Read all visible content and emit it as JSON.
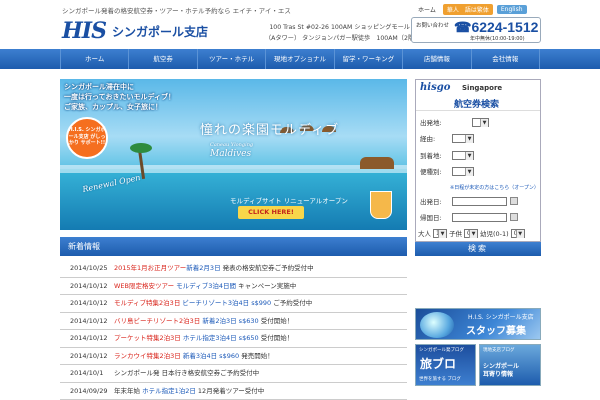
{
  "header": {
    "tagline": "シンガポール発着の格安航空券・ツアー・ホテル予約なら エイチ・アイ・エス",
    "logo": "HIS",
    "logo_sub": "シンガポール支店",
    "address_line1": "100 Tras St #02-26 100AM ショッピングモール",
    "address_line2": "（Aタワー） タンジョンパガー駅徒歩　100AM（2階）",
    "toplinks": {
      "home": "ホーム",
      "chinese": "華人　語は繁体",
      "english": "English"
    },
    "phone_label": "お問い合わせ",
    "phone": "6224-1512",
    "hours": "年中無休(10:00-19:00)"
  },
  "nav": [
    "ホーム",
    "航空券",
    "ツアー・ホテル",
    "現地オプショナル",
    "留学・ワーキング",
    "店舗情報",
    "会社情報"
  ],
  "banner": {
    "tagline_l1": "シンガポール滞在中に",
    "tagline_l2": "一度は行っておきたいモルディブ！",
    "tagline_l3": "ご家族、カップル、女子旅に！",
    "title": "憧れの楽園モルディブ",
    "logo_small": "Caneau Ylonging",
    "logo_big": "Maldives",
    "badge": "H.I.S. シンガポール支店 がしっかり サポート!!",
    "renew": "Renewal Open",
    "site": "モルディブサイト リニューアルオープン",
    "click": "CLICK HERE!"
  },
  "news": {
    "heading": "新着情報",
    "items": [
      {
        "date": "2014/10/25",
        "parts": [
          {
            "t": "2015年1月お正月ツアー",
            "c": "red"
          },
          {
            "t": "新着2月3日",
            "c": "blue"
          },
          {
            "t": " 発表の格安航空券ご予約受付中",
            "c": ""
          }
        ]
      },
      {
        "date": "2014/10/12",
        "parts": [
          {
            "t": "WEB限定格安ツアー",
            "c": "red"
          },
          {
            "t": " モルディブ3泊4日間 ",
            "c": "blue"
          },
          {
            "t": "キャンペーン実施中",
            "c": ""
          }
        ]
      },
      {
        "date": "2014/10/12",
        "parts": [
          {
            "t": "モルディブ特集2泊3日",
            "c": "red"
          },
          {
            "t": " ビーチリゾート3泊4日 s$990",
            "c": "blue"
          },
          {
            "t": " ご予約受付中",
            "c": ""
          }
        ]
      },
      {
        "date": "2014/10/12",
        "parts": [
          {
            "t": "バリ島ビーチリゾート2泊3日",
            "c": "red"
          },
          {
            "t": " 新着2泊3日 s$630",
            "c": "blue"
          },
          {
            "t": " 受付開始！",
            "c": ""
          }
        ]
      },
      {
        "date": "2014/10/12",
        "parts": [
          {
            "t": "プーケット特集2泊3日",
            "c": "red"
          },
          {
            "t": " ホテル指定3泊4日 s$650",
            "c": "blue"
          },
          {
            "t": " 受付開始！",
            "c": ""
          }
        ]
      },
      {
        "date": "2014/10/12",
        "parts": [
          {
            "t": "ランカウイ特集2泊3日",
            "c": "red"
          },
          {
            "t": " 新着3泊4日 s$960",
            "c": "blue"
          },
          {
            "t": " 発売開始！",
            "c": ""
          }
        ]
      },
      {
        "date": "2014/10/1",
        "parts": [
          {
            "t": "シンガポール発 ",
            "c": ""
          },
          {
            "t": "",
            "c": "blue"
          },
          {
            "t": "日本行き格安航空券ご予約受付中",
            "c": ""
          }
        ]
      },
      {
        "date": "2014/09/29",
        "parts": [
          {
            "t": "年末年始 ",
            "c": ""
          },
          {
            "t": "ホテル指定1泊2日",
            "c": "blue"
          },
          {
            "t": " 12月発着ツアー受付中",
            "c": ""
          }
        ]
      }
    ]
  },
  "search": {
    "brand": "hisgo",
    "brand_sub": "Singapore",
    "title": "航空券検索",
    "fields": [
      "出発地:",
      "経由:",
      "到着地:",
      "便種別:",
      "出発日:",
      "帰国日:"
    ],
    "link": "※日程が未定の方はこちら（オープン）",
    "pax_labels": [
      "大人",
      "子供",
      "幼児(0-1)"
    ],
    "pax_values": [
      "1",
      "0",
      "0"
    ],
    "button": "検索"
  },
  "side": {
    "staff_a": "H.I.S. シンガポール支店",
    "staff_b": "スタッフ募集",
    "blog1_top": "シンガポール発ブログ",
    "blog1_big": "旅ブロ",
    "blog1_sub": "世界を旅する ブログ",
    "blog2_top": "現地支店ブログ",
    "blog2_mid": "シンガポール",
    "blog2_sub": "耳寄り情報"
  }
}
